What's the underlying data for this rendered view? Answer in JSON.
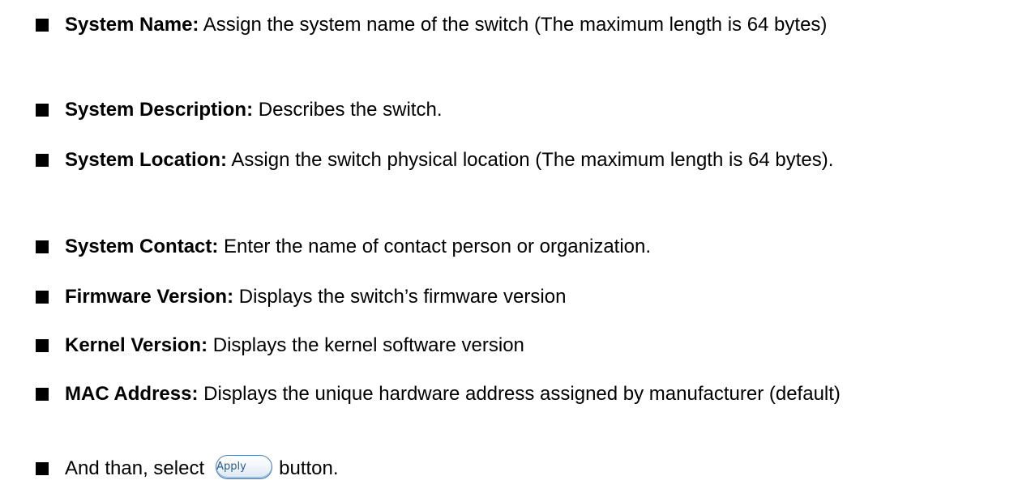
{
  "items": [
    {
      "label": "System Name:",
      "text": " Assign the system name of the switch (The maximum length is 64 bytes)"
    },
    {
      "label": "System Description:",
      "text": " Describes the switch."
    },
    {
      "label": "System Location:",
      "text": " Assign the switch physical location (The maximum length is 64 bytes)."
    },
    {
      "label": "System Contact:",
      "text": " Enter the name of contact person or organization."
    },
    {
      "label": "Firmware Version:",
      "text": " Displays the switch’s firmware version"
    },
    {
      "label": "Kernel Version:",
      "text": " Displays the kernel software version"
    },
    {
      "label": "MAC Address:",
      "text": " Displays the unique hardware address assigned by manufacturer (default)"
    }
  ],
  "final_item": {
    "prefix": "And than, select",
    "button_label": "Apply",
    "suffix": "button."
  },
  "bullet_icon": "filled-square-bullet-icon"
}
